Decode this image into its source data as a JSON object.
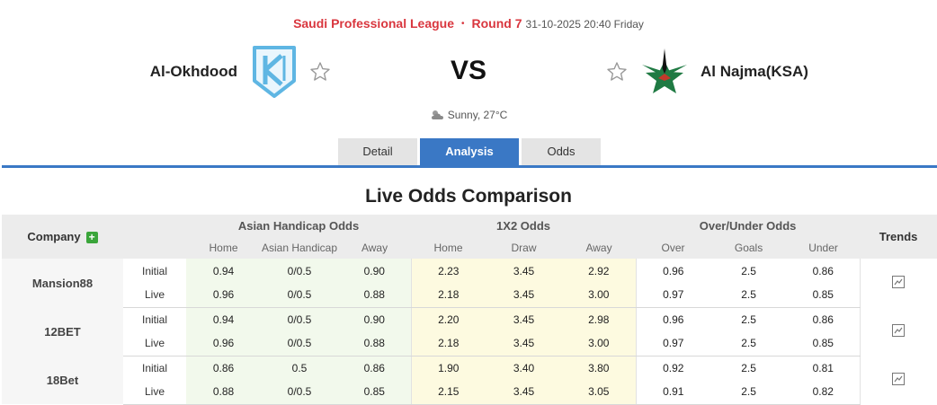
{
  "match": {
    "league": "Saudi Professional League",
    "separator": "•",
    "round": "Round 7",
    "datetime": "31-10-2025 20:40 Friday",
    "home_team": "Al-Okhdood",
    "away_team": "Al Najma(KSA)",
    "vs": "VS",
    "weather": "Sunny, 27°C"
  },
  "tabs": [
    {
      "label": "Detail",
      "active": false
    },
    {
      "label": "Analysis",
      "active": true
    },
    {
      "label": "Odds",
      "active": false
    }
  ],
  "section_title": "Live Odds Comparison",
  "table": {
    "company_header": "Company",
    "trends_header": "Trends",
    "groups": [
      "Asian Handicap Odds",
      "1X2 Odds",
      "Over/Under Odds"
    ],
    "subheaders": [
      "Home",
      "Asian Handicap",
      "Away",
      "Home",
      "Draw",
      "Away",
      "Over",
      "Goals",
      "Under"
    ],
    "companies": [
      {
        "name": "Mansion88",
        "rows": [
          {
            "type": "Initial",
            "ah": [
              "0.94",
              "0/0.5",
              "0.90"
            ],
            "x12": [
              "2.23",
              "3.45",
              "2.92"
            ],
            "ou": [
              "0.96",
              "2.5",
              "0.86"
            ]
          },
          {
            "type": "Live",
            "ah": [
              "0.96",
              "0/0.5",
              "0.88"
            ],
            "x12": [
              "2.18",
              "3.45",
              "3.00"
            ],
            "ou": [
              "0.97",
              "2.5",
              "0.85"
            ]
          }
        ]
      },
      {
        "name": "12BET",
        "rows": [
          {
            "type": "Initial",
            "ah": [
              "0.94",
              "0/0.5",
              "0.90"
            ],
            "x12": [
              "2.20",
              "3.45",
              "2.98"
            ],
            "ou": [
              "0.96",
              "2.5",
              "0.86"
            ]
          },
          {
            "type": "Live",
            "ah": [
              "0.96",
              "0/0.5",
              "0.88"
            ],
            "x12": [
              "2.18",
              "3.45",
              "3.00"
            ],
            "ou": [
              "0.97",
              "2.5",
              "0.85"
            ]
          }
        ]
      },
      {
        "name": "18Bet",
        "rows": [
          {
            "type": "Initial",
            "ah": [
              "0.86",
              "0.5",
              "0.86"
            ],
            "x12": [
              "1.90",
              "3.40",
              "3.80"
            ],
            "ou": [
              "0.92",
              "2.5",
              "0.81"
            ]
          },
          {
            "type": "Live",
            "ah": [
              "0.88",
              "0/0.5",
              "0.85"
            ],
            "x12": [
              "2.15",
              "3.45",
              "3.05"
            ],
            "ou": [
              "0.91",
              "2.5",
              "0.82"
            ]
          }
        ]
      }
    ]
  },
  "icons": {
    "home_logo": "okhdood-shield-logo",
    "away_logo": "najma-star-logo",
    "favorite": "star-outline-icon",
    "weather": "sun-cloud-icon",
    "add": "plus-icon",
    "trend": "line-chart-icon"
  },
  "colors": {
    "accent": "#3a78c5",
    "league_red": "#d9363e",
    "ah_bg": "#f2f9ec",
    "x12_bg": "#fdfae0",
    "header_bg": "#ececec",
    "add_green": "#3aa53a"
  }
}
